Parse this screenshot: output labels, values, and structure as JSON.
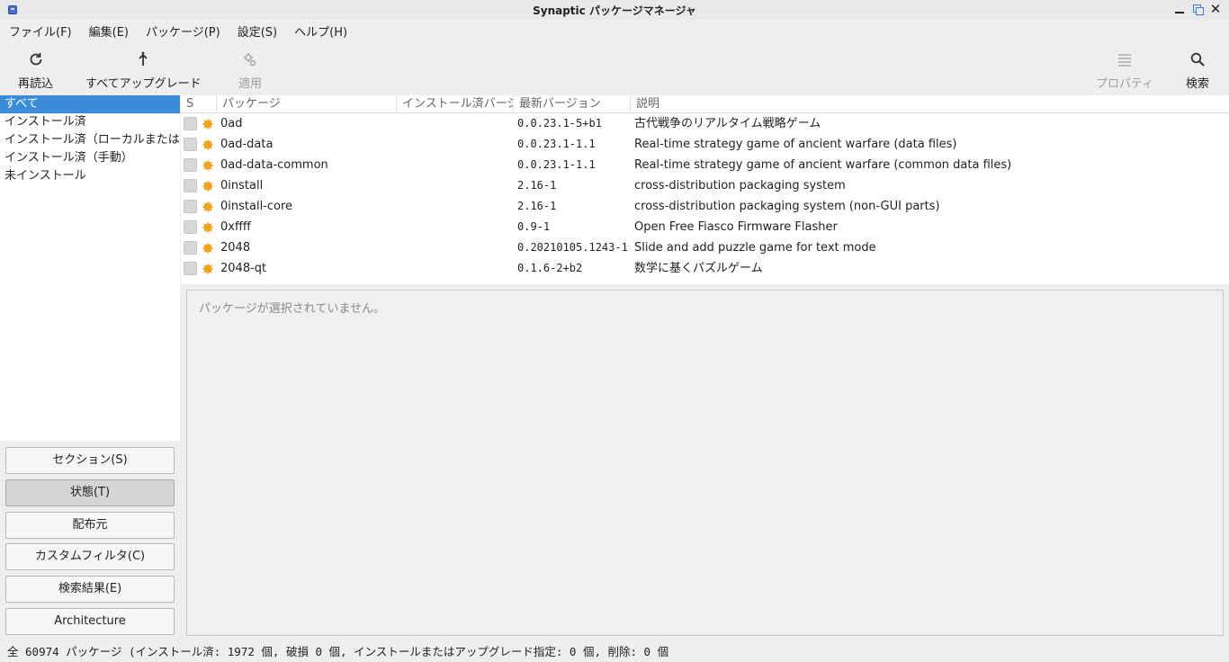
{
  "window": {
    "title": "Synaptic パッケージマネージャ",
    "controls": {
      "minimize_icon": "minimize-icon",
      "maximize_icon": "maximize-icon",
      "close": "✕"
    }
  },
  "menu": [
    "ファイル(F)",
    "編集(E)",
    "パッケージ(P)",
    "設定(S)",
    "ヘルプ(H)"
  ],
  "toolbar": {
    "reload": "再読込",
    "upgrade_all": "すべてアップグレード",
    "apply": "適用",
    "properties": "プロパティ",
    "search": "検索"
  },
  "filters": [
    "すべて",
    "インストール済",
    "インストール済（ローカルまたは",
    "インストール済（手動）",
    "未インストール"
  ],
  "filter_buttons": [
    "セクション(S)",
    "状態(T)",
    "配布元",
    "カスタムフィルタ(C)",
    "検索結果(E)",
    "Architecture"
  ],
  "columns": {
    "s": "S",
    "package": "パッケージ",
    "installed": "インストール済バージョン",
    "latest": "最新バージョン",
    "description": "説明"
  },
  "packages": [
    {
      "name": "0ad",
      "installed": "",
      "latest": "0.0.23.1-5+b1",
      "description": "古代戦争のリアルタイム戦略ゲーム"
    },
    {
      "name": "0ad-data",
      "installed": "",
      "latest": "0.0.23.1-1.1",
      "description": "Real-time strategy game of ancient warfare (data files)"
    },
    {
      "name": "0ad-data-common",
      "installed": "",
      "latest": "0.0.23.1-1.1",
      "description": "Real-time strategy game of ancient warfare (common data files)"
    },
    {
      "name": "0install",
      "installed": "",
      "latest": "2.16-1",
      "description": "cross-distribution packaging system"
    },
    {
      "name": "0install-core",
      "installed": "",
      "latest": "2.16-1",
      "description": "cross-distribution packaging system (non-GUI parts)"
    },
    {
      "name": "0xffff",
      "installed": "",
      "latest": "0.9-1",
      "description": "Open Free Fiasco Firmware Flasher"
    },
    {
      "name": "2048",
      "installed": "",
      "latest": "0.20210105.1243-1",
      "description": "Slide and add puzzle game for text mode"
    },
    {
      "name": "2048-qt",
      "installed": "",
      "latest": "0.1.6-2+b2",
      "description": "数学に基くパズルゲーム"
    }
  ],
  "detail": {
    "empty_text": "パッケージが選択されていません。"
  },
  "status": "全 60974 パッケージ (インストール済: 1972 個, 破損 0 個, インストールまたはアップグレード指定: 0 個, 削除: 0 個",
  "colors": {
    "selection": "#3a8cd9",
    "status_icon": "#f2a31b"
  }
}
